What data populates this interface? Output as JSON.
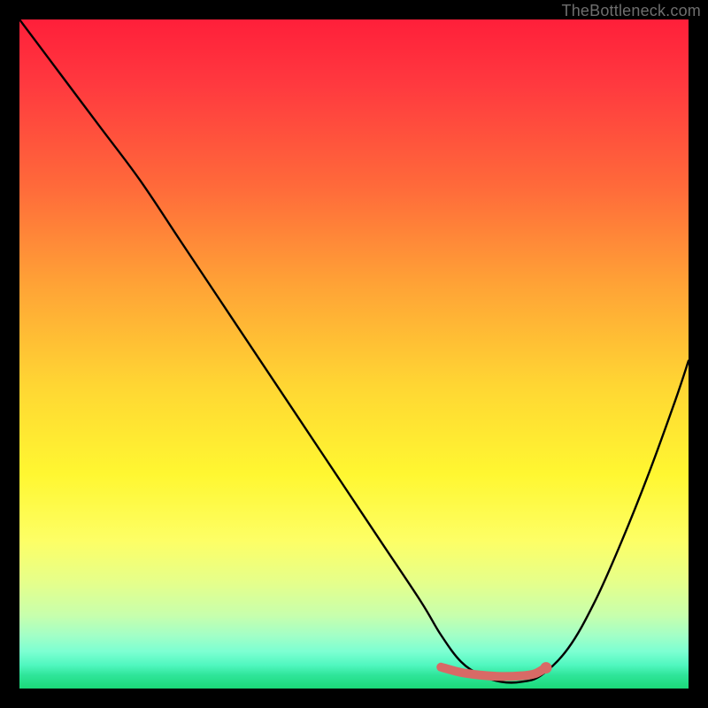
{
  "watermark": "TheBottleneck.com",
  "chart_data": {
    "type": "line",
    "title": "",
    "xlabel": "",
    "ylabel": "",
    "xlim": [
      0,
      100
    ],
    "ylim": [
      0,
      100
    ],
    "grid": false,
    "legend": false,
    "background_gradient": {
      "top": "#ff1f3a",
      "mid_upper": "#ffa436",
      "mid": "#fff731",
      "mid_lower": "#c8ffac",
      "bottom": "#1bd979"
    },
    "series": [
      {
        "name": "bottleneck-curve",
        "color": "#000000",
        "x": [
          0,
          6,
          12,
          18,
          24,
          30,
          36,
          42,
          48,
          54,
          60,
          63,
          66,
          69,
          72,
          75,
          78,
          82,
          86,
          90,
          94,
          98,
          100
        ],
        "y": [
          100,
          92,
          84,
          76,
          67,
          58,
          49,
          40,
          31,
          22,
          13,
          8,
          4,
          2,
          1,
          1,
          2,
          6,
          13,
          22,
          32,
          43,
          49
        ]
      },
      {
        "name": "highlight-band",
        "color": "#d86a66",
        "x": [
          63,
          66,
          69,
          72,
          75,
          77,
          78.5
        ],
        "y": [
          3.2,
          2.4,
          2.0,
          1.8,
          1.9,
          2.2,
          3.0
        ]
      },
      {
        "name": "highlight-dot",
        "color": "#d86a66",
        "x": [
          78.7
        ],
        "y": [
          3.1
        ]
      }
    ]
  }
}
